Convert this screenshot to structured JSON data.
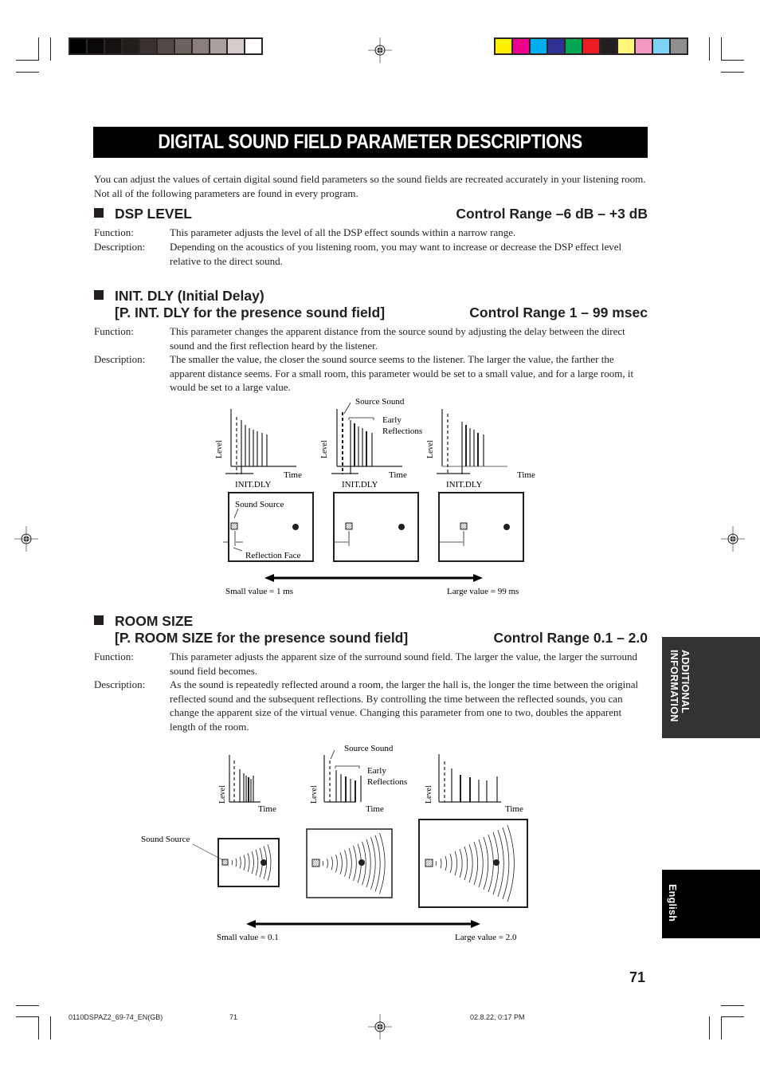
{
  "print_marks": {
    "grayscale_swatches": [
      "#000000",
      "#0a0807",
      "#151110",
      "#221e1c",
      "#3a3230",
      "#524846",
      "#6c625f",
      "#8a7f7d",
      "#a9a09e",
      "#d3cccb",
      "#ffffff"
    ],
    "color_swatches": [
      "#fff200",
      "#ec008c",
      "#00aeef",
      "#2e3192",
      "#00a651",
      "#ed1c24",
      "#231f20",
      "#fff77c",
      "#f49ac1",
      "#7dd4f7",
      "#8f8f8f"
    ]
  },
  "page": {
    "title": "DIGITAL SOUND FIELD PARAMETER DESCRIPTIONS",
    "intro": "You can adjust the values of certain digital sound field parameters so the sound fields are recreated accurately in your listening room. Not all of the following parameters are found in every program.",
    "sections": [
      {
        "heading_line1": "DSP LEVEL",
        "heading_line2": "",
        "control_range": "Control Range –6 dB – +3 dB",
        "function_label": "Function:",
        "function_text": "This parameter adjusts the level of all the DSP effect sounds within a narrow range.",
        "description_label": "Description:",
        "description_text": "Depending on the acoustics of you listening room, you may want to increase or decrease the DSP effect level relative to the direct sound."
      },
      {
        "heading_line1": "INIT. DLY (Initial Delay)",
        "heading_line2": "[P. INT. DLY for the presence sound field]",
        "control_range": "Control Range 1 – 99 msec",
        "function_label": "Function:",
        "function_text": "This parameter changes the apparent distance from the source sound by adjusting the delay between the direct sound and the first reflection heard by the listener.",
        "description_label": "Description:",
        "description_text": "The smaller the value, the closer the sound source seems to the listener. The larger the value, the farther the apparent distance seems. For a small room, this parameter would be set to a small value, and for a large room, it would be set to a large value."
      },
      {
        "heading_line1": "ROOM SIZE",
        "heading_line2": "[P. ROOM SIZE for the presence sound field]",
        "control_range": "Control Range 0.1 – 2.0",
        "function_label": "Function:",
        "function_text": "This parameter adjusts the apparent size of the surround sound field. The larger the value, the larger the surround sound field becomes.",
        "description_label": "Description:",
        "description_text": "As the sound is repeatedly reflected around a room, the larger the hall is, the longer the time between the original reflected sound and the subsequent reflections. By controlling the time between the reflected sounds, you can change the apparent size of the virtual venue. Changing this parameter from one to two, doubles the apparent length of the room."
      }
    ]
  },
  "diagram_init_dly": {
    "level_label": "Level",
    "time_label": "Time",
    "init_dly_label": "INIT.DLY",
    "source_sound_label": "Source Sound",
    "early_reflections_line1": "Early",
    "early_reflections_line2": "Reflections",
    "sound_source_label": "Sound Source",
    "reflection_face_label": "Reflection Face",
    "small_value_label": "Small value = 1 ms",
    "large_value_label": "Large value = 99 ms"
  },
  "diagram_room_size": {
    "level_label": "Level",
    "time_label": "Time",
    "source_sound_label": "Source Sound",
    "early_reflections_line1": "Early",
    "early_reflections_line2": "Reflections",
    "sound_source_label": "Sound Source",
    "small_value_label": "Small value = 0.1",
    "large_value_label": "Large value = 2.0"
  },
  "side_tabs": {
    "section_line1": "ADDITIONAL",
    "section_line2": "INFORMATION",
    "language": "English"
  },
  "page_number": "71",
  "footer": {
    "file_name": "0110DSPAZ2_69-74_EN(GB)",
    "page": "71",
    "timestamp": "02.8.22, 0:17 PM"
  }
}
